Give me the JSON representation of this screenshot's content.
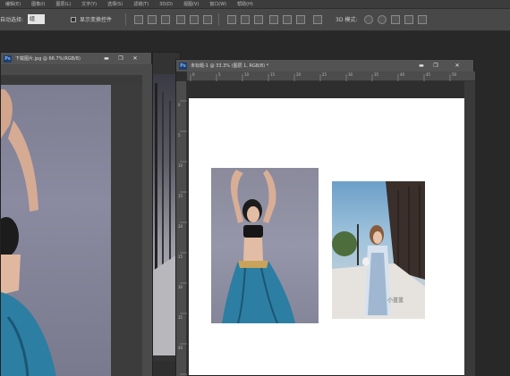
{
  "menubar": {
    "items": [
      "编辑(E)",
      "图像(I)",
      "图层(L)",
      "文字(Y)",
      "选择(S)",
      "滤镜(T)",
      "3D(D)",
      "视图(V)",
      "窗口(W)",
      "帮助(H)"
    ]
  },
  "options": {
    "auto_select_label": "自动选择:",
    "auto_select_value": "组",
    "show_transform_label": "显示变换控件",
    "mode_3d_label": "3D 模式:"
  },
  "windows": {
    "back_window_title": "下载图片.jpg @ 66.7%(RGB/8)",
    "front_window_title": "未标题-1 @ 33.3% (图层 1, RGB/8) *",
    "minimize_glyph": "▬",
    "restore_glyph": "❐",
    "close_glyph": "✕"
  },
  "rulers": {
    "top": [
      "0",
      "5",
      "10",
      "15",
      "20",
      "25",
      "30",
      "35",
      "40",
      "45",
      "50"
    ],
    "left": [
      "0",
      "5",
      "10",
      "15",
      "20",
      "25",
      "30",
      "35",
      "40",
      "45"
    ]
  },
  "photos": {
    "watermark": "小蓝蓝"
  },
  "colors": {
    "app_bg": "#282828",
    "canvas": "#ffffff",
    "skirt": "#2d7ea3"
  },
  "icons": [
    "photoshop-logo-icon",
    "align-icon",
    "distribute-icon",
    "rotate-3d-icon",
    "pan-3d-icon",
    "slide-3d-icon",
    "scale-3d-icon"
  ]
}
